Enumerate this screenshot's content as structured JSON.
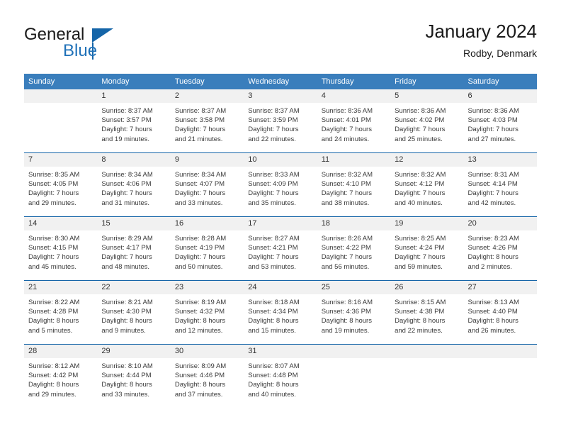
{
  "brand": {
    "name_part1": "General",
    "name_part2": "Blue",
    "triangle_color": "#1565a8"
  },
  "header": {
    "title": "January 2024",
    "subtitle": "Rodby, Denmark"
  },
  "theme": {
    "header_bg": "#3a7ebc",
    "row_divider": "#1565a8",
    "daynum_bg": "#f1f1f1"
  },
  "weekdays": [
    "Sunday",
    "Monday",
    "Tuesday",
    "Wednesday",
    "Thursday",
    "Friday",
    "Saturday"
  ],
  "weeks": [
    [
      {
        "day": "",
        "sunrise": "",
        "sunset": "",
        "daylight1": "",
        "daylight2": ""
      },
      {
        "day": "1",
        "sunrise": "Sunrise: 8:37 AM",
        "sunset": "Sunset: 3:57 PM",
        "daylight1": "Daylight: 7 hours",
        "daylight2": "and 19 minutes."
      },
      {
        "day": "2",
        "sunrise": "Sunrise: 8:37 AM",
        "sunset": "Sunset: 3:58 PM",
        "daylight1": "Daylight: 7 hours",
        "daylight2": "and 21 minutes."
      },
      {
        "day": "3",
        "sunrise": "Sunrise: 8:37 AM",
        "sunset": "Sunset: 3:59 PM",
        "daylight1": "Daylight: 7 hours",
        "daylight2": "and 22 minutes."
      },
      {
        "day": "4",
        "sunrise": "Sunrise: 8:36 AM",
        "sunset": "Sunset: 4:01 PM",
        "daylight1": "Daylight: 7 hours",
        "daylight2": "and 24 minutes."
      },
      {
        "day": "5",
        "sunrise": "Sunrise: 8:36 AM",
        "sunset": "Sunset: 4:02 PM",
        "daylight1": "Daylight: 7 hours",
        "daylight2": "and 25 minutes."
      },
      {
        "day": "6",
        "sunrise": "Sunrise: 8:36 AM",
        "sunset": "Sunset: 4:03 PM",
        "daylight1": "Daylight: 7 hours",
        "daylight2": "and 27 minutes."
      }
    ],
    [
      {
        "day": "7",
        "sunrise": "Sunrise: 8:35 AM",
        "sunset": "Sunset: 4:05 PM",
        "daylight1": "Daylight: 7 hours",
        "daylight2": "and 29 minutes."
      },
      {
        "day": "8",
        "sunrise": "Sunrise: 8:34 AM",
        "sunset": "Sunset: 4:06 PM",
        "daylight1": "Daylight: 7 hours",
        "daylight2": "and 31 minutes."
      },
      {
        "day": "9",
        "sunrise": "Sunrise: 8:34 AM",
        "sunset": "Sunset: 4:07 PM",
        "daylight1": "Daylight: 7 hours",
        "daylight2": "and 33 minutes."
      },
      {
        "day": "10",
        "sunrise": "Sunrise: 8:33 AM",
        "sunset": "Sunset: 4:09 PM",
        "daylight1": "Daylight: 7 hours",
        "daylight2": "and 35 minutes."
      },
      {
        "day": "11",
        "sunrise": "Sunrise: 8:32 AM",
        "sunset": "Sunset: 4:10 PM",
        "daylight1": "Daylight: 7 hours",
        "daylight2": "and 38 minutes."
      },
      {
        "day": "12",
        "sunrise": "Sunrise: 8:32 AM",
        "sunset": "Sunset: 4:12 PM",
        "daylight1": "Daylight: 7 hours",
        "daylight2": "and 40 minutes."
      },
      {
        "day": "13",
        "sunrise": "Sunrise: 8:31 AM",
        "sunset": "Sunset: 4:14 PM",
        "daylight1": "Daylight: 7 hours",
        "daylight2": "and 42 minutes."
      }
    ],
    [
      {
        "day": "14",
        "sunrise": "Sunrise: 8:30 AM",
        "sunset": "Sunset: 4:15 PM",
        "daylight1": "Daylight: 7 hours",
        "daylight2": "and 45 minutes."
      },
      {
        "day": "15",
        "sunrise": "Sunrise: 8:29 AM",
        "sunset": "Sunset: 4:17 PM",
        "daylight1": "Daylight: 7 hours",
        "daylight2": "and 48 minutes."
      },
      {
        "day": "16",
        "sunrise": "Sunrise: 8:28 AM",
        "sunset": "Sunset: 4:19 PM",
        "daylight1": "Daylight: 7 hours",
        "daylight2": "and 50 minutes."
      },
      {
        "day": "17",
        "sunrise": "Sunrise: 8:27 AM",
        "sunset": "Sunset: 4:21 PM",
        "daylight1": "Daylight: 7 hours",
        "daylight2": "and 53 minutes."
      },
      {
        "day": "18",
        "sunrise": "Sunrise: 8:26 AM",
        "sunset": "Sunset: 4:22 PM",
        "daylight1": "Daylight: 7 hours",
        "daylight2": "and 56 minutes."
      },
      {
        "day": "19",
        "sunrise": "Sunrise: 8:25 AM",
        "sunset": "Sunset: 4:24 PM",
        "daylight1": "Daylight: 7 hours",
        "daylight2": "and 59 minutes."
      },
      {
        "day": "20",
        "sunrise": "Sunrise: 8:23 AM",
        "sunset": "Sunset: 4:26 PM",
        "daylight1": "Daylight: 8 hours",
        "daylight2": "and 2 minutes."
      }
    ],
    [
      {
        "day": "21",
        "sunrise": "Sunrise: 8:22 AM",
        "sunset": "Sunset: 4:28 PM",
        "daylight1": "Daylight: 8 hours",
        "daylight2": "and 5 minutes."
      },
      {
        "day": "22",
        "sunrise": "Sunrise: 8:21 AM",
        "sunset": "Sunset: 4:30 PM",
        "daylight1": "Daylight: 8 hours",
        "daylight2": "and 9 minutes."
      },
      {
        "day": "23",
        "sunrise": "Sunrise: 8:19 AM",
        "sunset": "Sunset: 4:32 PM",
        "daylight1": "Daylight: 8 hours",
        "daylight2": "and 12 minutes."
      },
      {
        "day": "24",
        "sunrise": "Sunrise: 8:18 AM",
        "sunset": "Sunset: 4:34 PM",
        "daylight1": "Daylight: 8 hours",
        "daylight2": "and 15 minutes."
      },
      {
        "day": "25",
        "sunrise": "Sunrise: 8:16 AM",
        "sunset": "Sunset: 4:36 PM",
        "daylight1": "Daylight: 8 hours",
        "daylight2": "and 19 minutes."
      },
      {
        "day": "26",
        "sunrise": "Sunrise: 8:15 AM",
        "sunset": "Sunset: 4:38 PM",
        "daylight1": "Daylight: 8 hours",
        "daylight2": "and 22 minutes."
      },
      {
        "day": "27",
        "sunrise": "Sunrise: 8:13 AM",
        "sunset": "Sunset: 4:40 PM",
        "daylight1": "Daylight: 8 hours",
        "daylight2": "and 26 minutes."
      }
    ],
    [
      {
        "day": "28",
        "sunrise": "Sunrise: 8:12 AM",
        "sunset": "Sunset: 4:42 PM",
        "daylight1": "Daylight: 8 hours",
        "daylight2": "and 29 minutes."
      },
      {
        "day": "29",
        "sunrise": "Sunrise: 8:10 AM",
        "sunset": "Sunset: 4:44 PM",
        "daylight1": "Daylight: 8 hours",
        "daylight2": "and 33 minutes."
      },
      {
        "day": "30",
        "sunrise": "Sunrise: 8:09 AM",
        "sunset": "Sunset: 4:46 PM",
        "daylight1": "Daylight: 8 hours",
        "daylight2": "and 37 minutes."
      },
      {
        "day": "31",
        "sunrise": "Sunrise: 8:07 AM",
        "sunset": "Sunset: 4:48 PM",
        "daylight1": "Daylight: 8 hours",
        "daylight2": "and 40 minutes."
      },
      {
        "day": "",
        "sunrise": "",
        "sunset": "",
        "daylight1": "",
        "daylight2": ""
      },
      {
        "day": "",
        "sunrise": "",
        "sunset": "",
        "daylight1": "",
        "daylight2": ""
      },
      {
        "day": "",
        "sunrise": "",
        "sunset": "",
        "daylight1": "",
        "daylight2": ""
      }
    ]
  ]
}
